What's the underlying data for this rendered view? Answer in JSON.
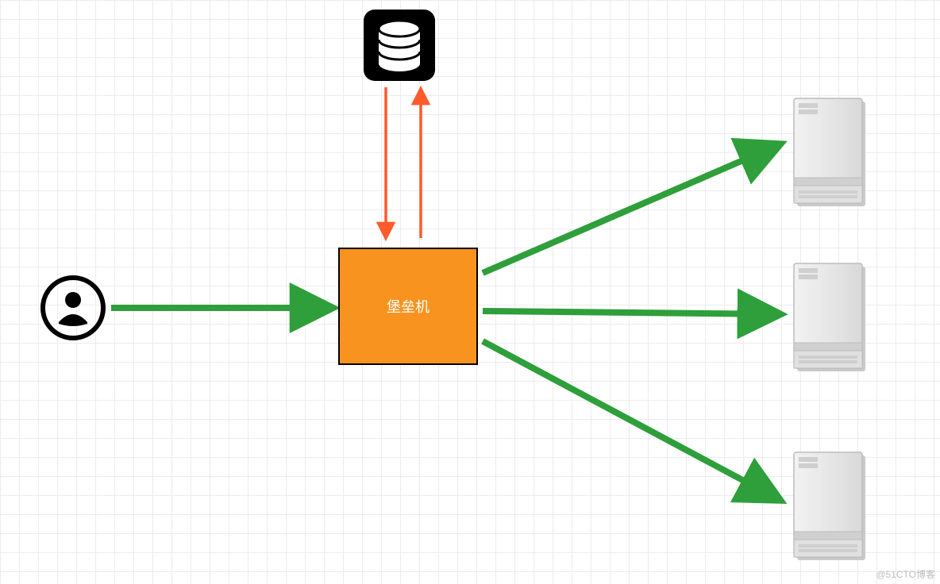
{
  "diagram": {
    "bastion_label": "堡垒机",
    "watermark": "@51CTO博客",
    "nodes": {
      "user": "user-icon",
      "database": "database-icon",
      "bastion": "bastion-host-box",
      "servers": [
        "server-1",
        "server-2",
        "server-3"
      ]
    },
    "arrows": {
      "user_to_bastion": {
        "color": "#2e9f3a",
        "desc": "user → bastion"
      },
      "bastion_to_db_down": {
        "color": "#ff5a2c",
        "desc": "db → bastion"
      },
      "bastion_to_db_up": {
        "color": "#ff5a2c",
        "desc": "bastion → db"
      },
      "bastion_to_servers": {
        "color": "#2e9f3a",
        "desc": "bastion → 3 servers"
      }
    },
    "colors": {
      "green": "#2e9f3a",
      "orange_box": "#f7931e",
      "red_arrow": "#ff5a2c",
      "black": "#000000",
      "grid": "#ececec",
      "server_fill": "#e7e7e7",
      "server_stroke": "#bcbcbc"
    }
  }
}
